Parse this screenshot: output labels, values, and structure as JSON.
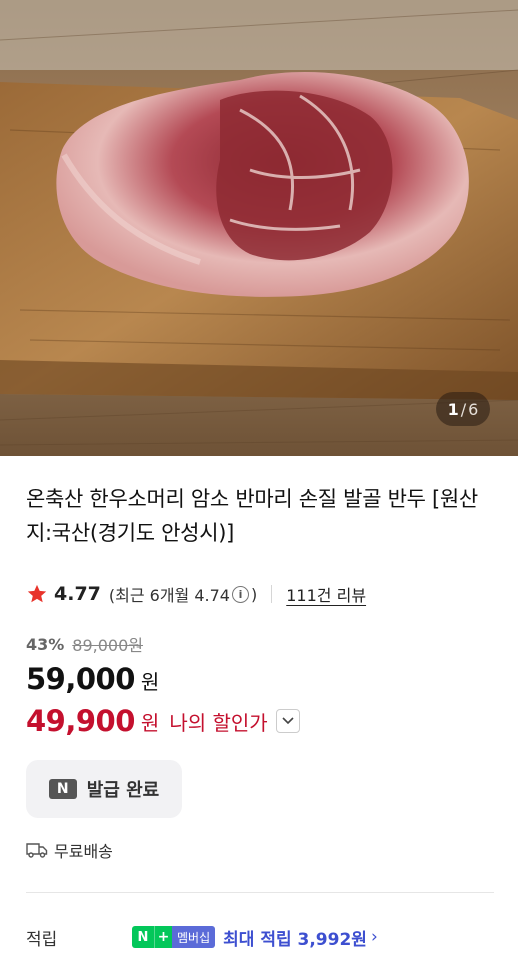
{
  "hero": {
    "image_subject": "raw beef chuck on wooden cutting board",
    "pager": {
      "current": "1",
      "separator": "/",
      "total": "6"
    }
  },
  "product": {
    "title": "온축산 한우소머리 암소 반마리 손질 발골 반두 [원산지:국산(경기도 안성시)]",
    "rating": "4.77",
    "recent_rating_label": "(최근 6개월 4.74",
    "recent_rating_close": ")",
    "info_icon": "i",
    "review_count": "111건 리뷰",
    "discount_rate": "43%",
    "original_price": "89,000원",
    "price": "59,000",
    "price_unit": "원",
    "my_price": "49,900",
    "my_price_unit": "원",
    "my_price_label": "나의 할인가",
    "coupon_badge": "N",
    "coupon_label": "발급 완료",
    "shipping_label": "무료배송",
    "points_title": "적립",
    "membership_n": "N",
    "membership_plus": "+",
    "membership_label": "멤버십",
    "max_points": "최대 적립 3,992원",
    "max_points_arrow": "›"
  },
  "colors": {
    "discount_red": "#c4102e",
    "star": "#e8332b",
    "naver_green": "#03c75a",
    "points_blue": "#3d4fd0"
  },
  "icons": [
    "star-icon",
    "info-icon",
    "chevron-down-icon",
    "truck-icon",
    "chevron-right-icon"
  ]
}
